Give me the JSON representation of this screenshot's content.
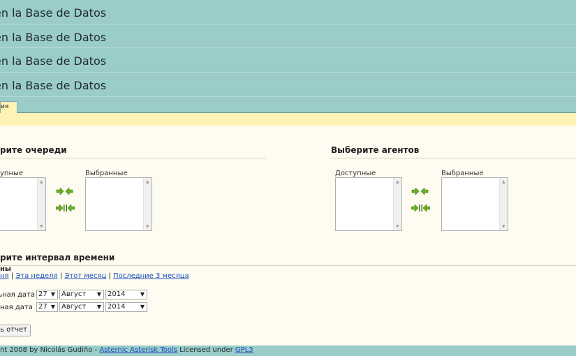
{
  "header": {
    "rows": [
      "en la Base de Datos",
      "en la Base de Datos",
      "en la Base de Datos",
      "en la Base de Datos"
    ]
  },
  "tabs": [
    {
      "label": "ия"
    }
  ],
  "queues": {
    "title": "рите очереди",
    "available_label": "упные",
    "selected_label": "Выбранные"
  },
  "agents": {
    "title": "Выберите агентов",
    "available_label": "Доступные",
    "selected_label": "Выбранные"
  },
  "icons": {
    "move_selected": "move-selected-arrows-icon",
    "move_all": "move-all-arrows-icon",
    "accent_green": "#6ab023"
  },
  "time": {
    "title": "рите интервал времени",
    "period_label": "ны",
    "links": [
      "ня",
      "Эта неделя",
      "Этот месяц",
      "Последние 3 месяца"
    ],
    "separator": "|",
    "start_label": "льная дата",
    "end_label": "ная дата",
    "start": {
      "day": "27",
      "month": "Август",
      "year": "2014"
    },
    "end": {
      "day": "27",
      "month": "Август",
      "year": "2014"
    }
  },
  "submit_label": "ать отчет",
  "footer": {
    "prefix": "nt 2008 by Nicolás Gudiño - ",
    "tool_link": "Asternic Asterisk Tools",
    "middle": " Licensed under ",
    "license_link": "GPL3"
  }
}
